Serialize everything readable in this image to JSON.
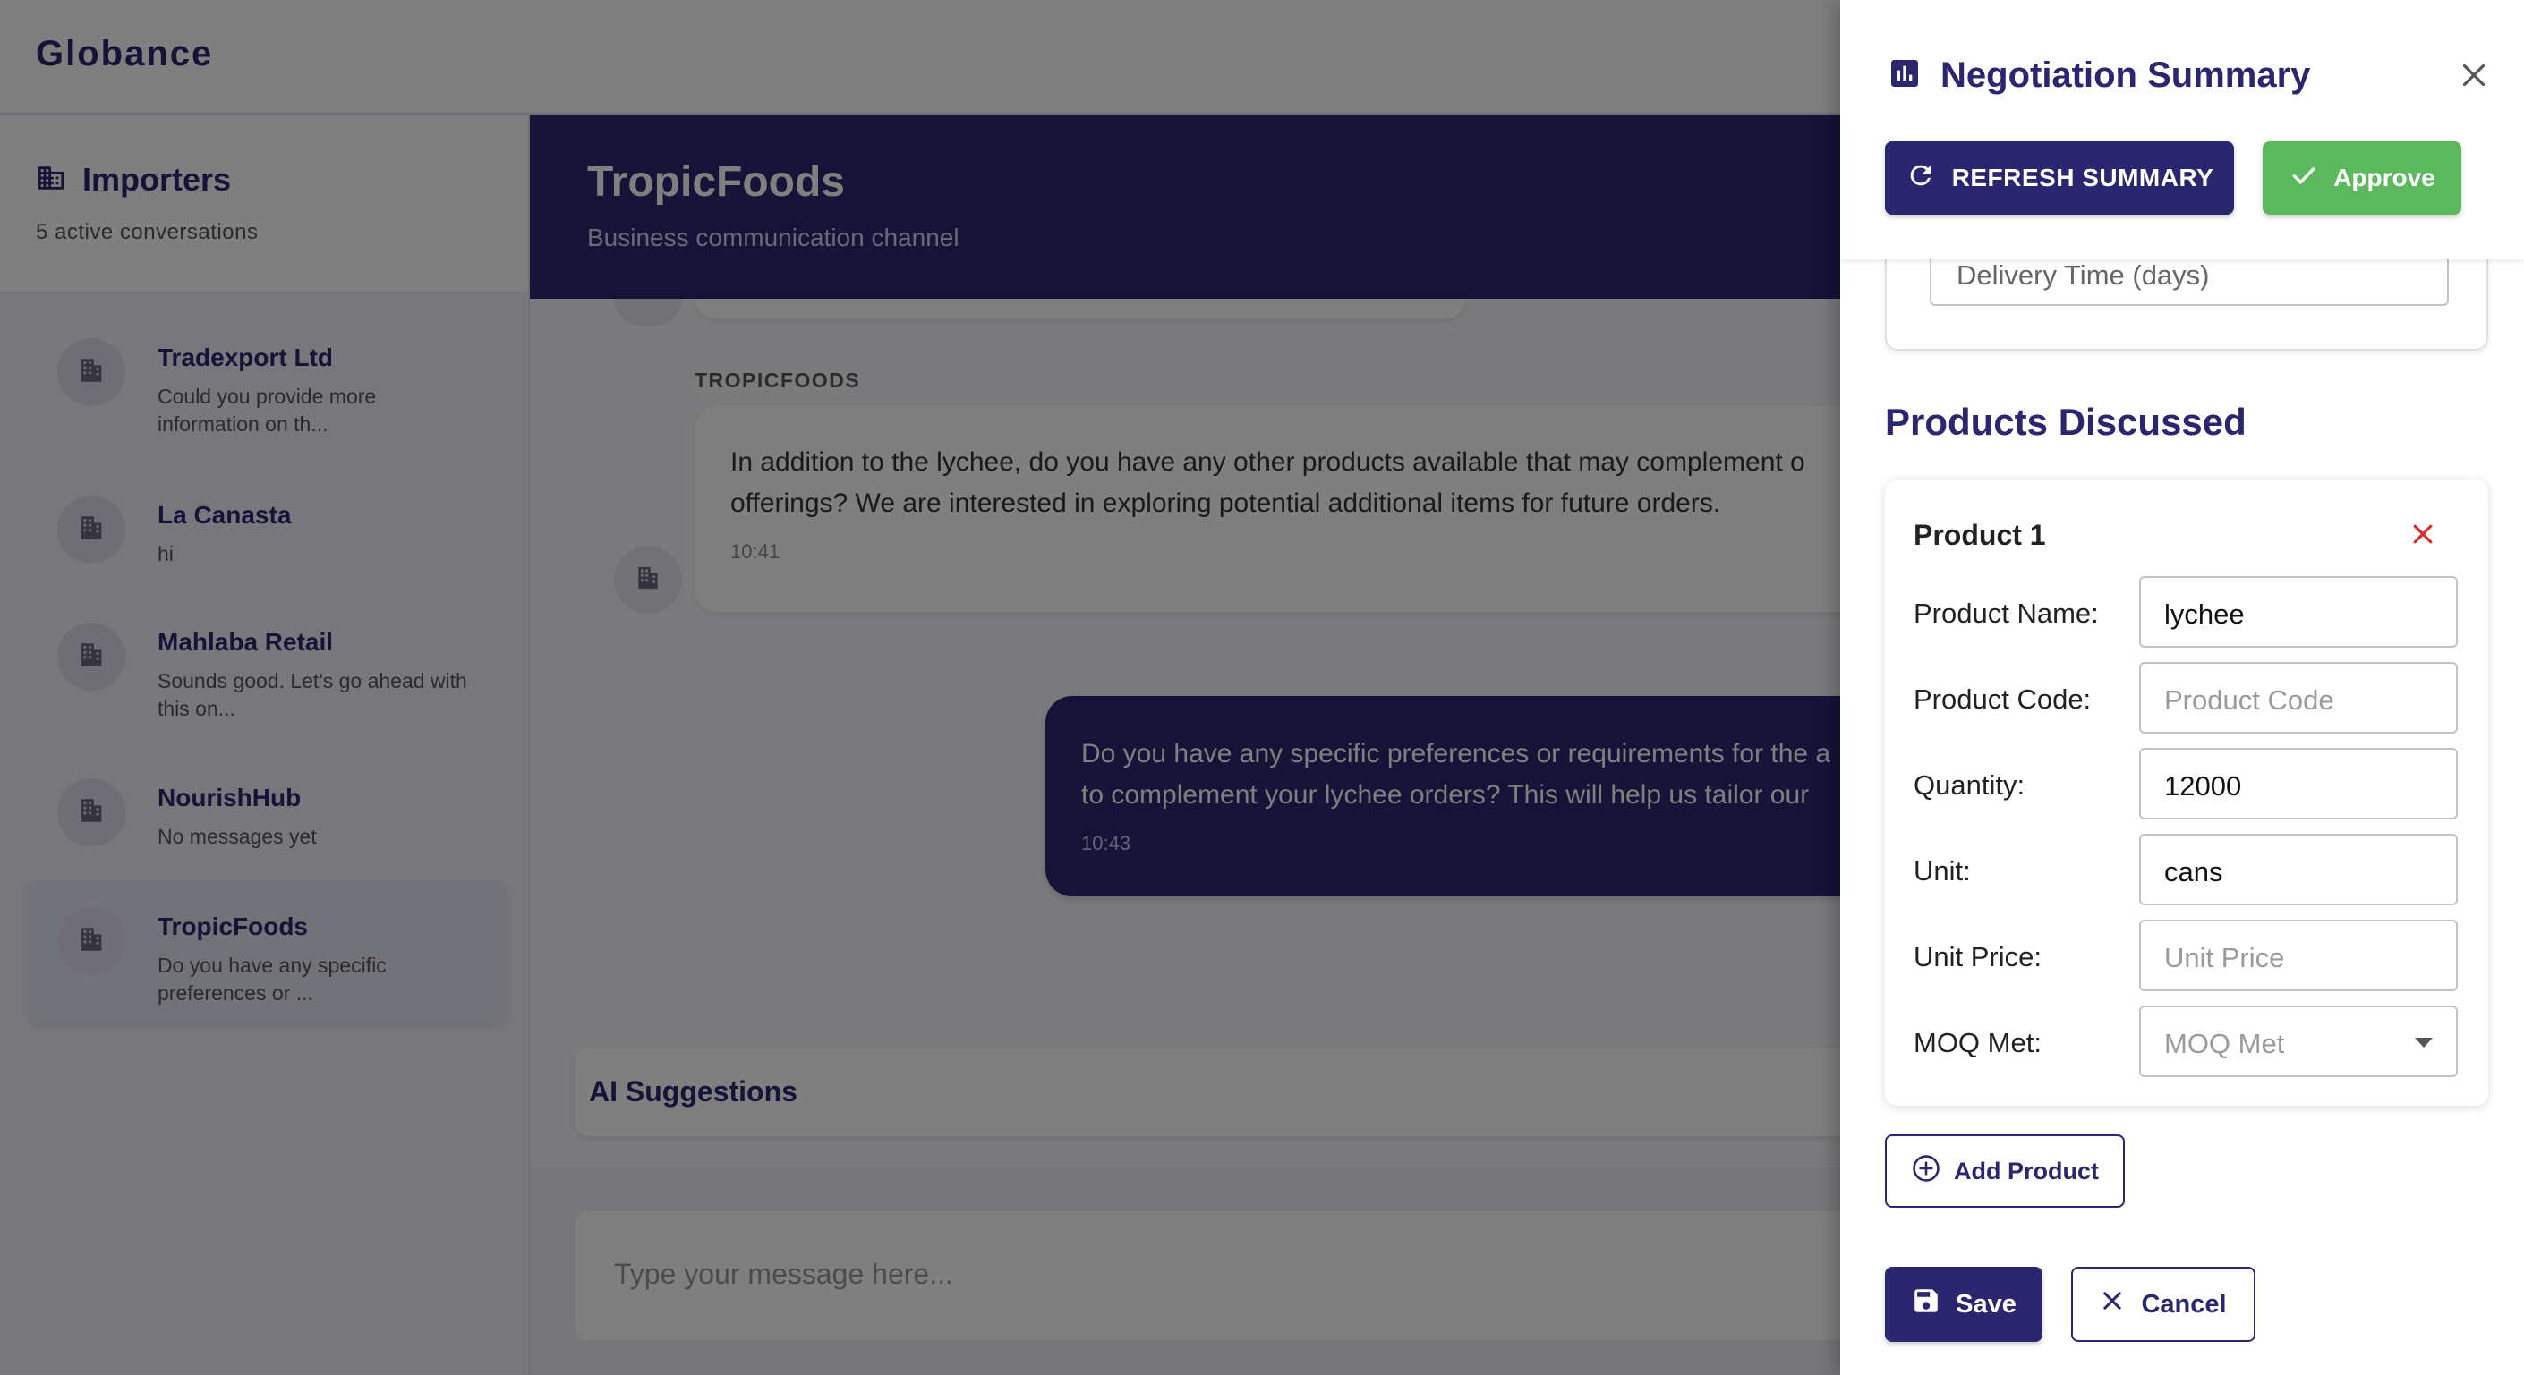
{
  "app": {
    "brand": "Globance"
  },
  "sidebar": {
    "title": "Importers",
    "subtitle": "5 active conversations",
    "conversations": [
      {
        "name": "Tradexport Ltd",
        "preview": "Could you provide more information on th..."
      },
      {
        "name": "La Canasta",
        "preview": "hi"
      },
      {
        "name": "Mahlaba Retail",
        "preview": "Sounds good. Let's go ahead with this on..."
      },
      {
        "name": "NourishHub",
        "preview": "No messages yet"
      },
      {
        "name": "TropicFoods",
        "preview": "Do you have any specific preferences or ..."
      }
    ]
  },
  "chat": {
    "title": "TropicFoods",
    "subtitle": "Business communication channel",
    "messages": [
      {
        "sender": "TROPICFOODS",
        "text": "In addition to the lychee, do you have any other products available that may complement o\nofferings? We are interested in exploring potential additional items for future orders.",
        "time": "10:41"
      },
      {
        "text": "Do you have any specific preferences or requirements for the a\nto complement your lychee orders? This will help us tailor our",
        "time": "10:43"
      }
    ],
    "ai_suggestions_label": "AI Suggestions",
    "composer_placeholder": "Type your message here..."
  },
  "drawer": {
    "title": "Negotiation Summary",
    "refresh_label": "REFRESH SUMMARY",
    "approve_label": "Approve",
    "delivery_time_placeholder": "Delivery Time (days)",
    "products_title": "Products Discussed",
    "product": {
      "heading": "Product 1",
      "fields": [
        {
          "label": "Product Name:",
          "value": "lychee",
          "placeholder": ""
        },
        {
          "label": "Product Code:",
          "value": "",
          "placeholder": "Product Code"
        },
        {
          "label": "Quantity:",
          "value": "12000",
          "placeholder": ""
        },
        {
          "label": "Unit:",
          "value": "cans",
          "placeholder": ""
        },
        {
          "label": "Unit Price:",
          "value": "",
          "placeholder": "Unit Price"
        },
        {
          "label": "MOQ Met:",
          "value": "",
          "placeholder": "MOQ Met"
        }
      ]
    },
    "add_product_label": "Add Product",
    "save_label": "Save",
    "cancel_label": "Cancel"
  },
  "colors": {
    "primary": "#2a2670",
    "approve": "#5cb85c",
    "remove": "#d32f2f"
  }
}
